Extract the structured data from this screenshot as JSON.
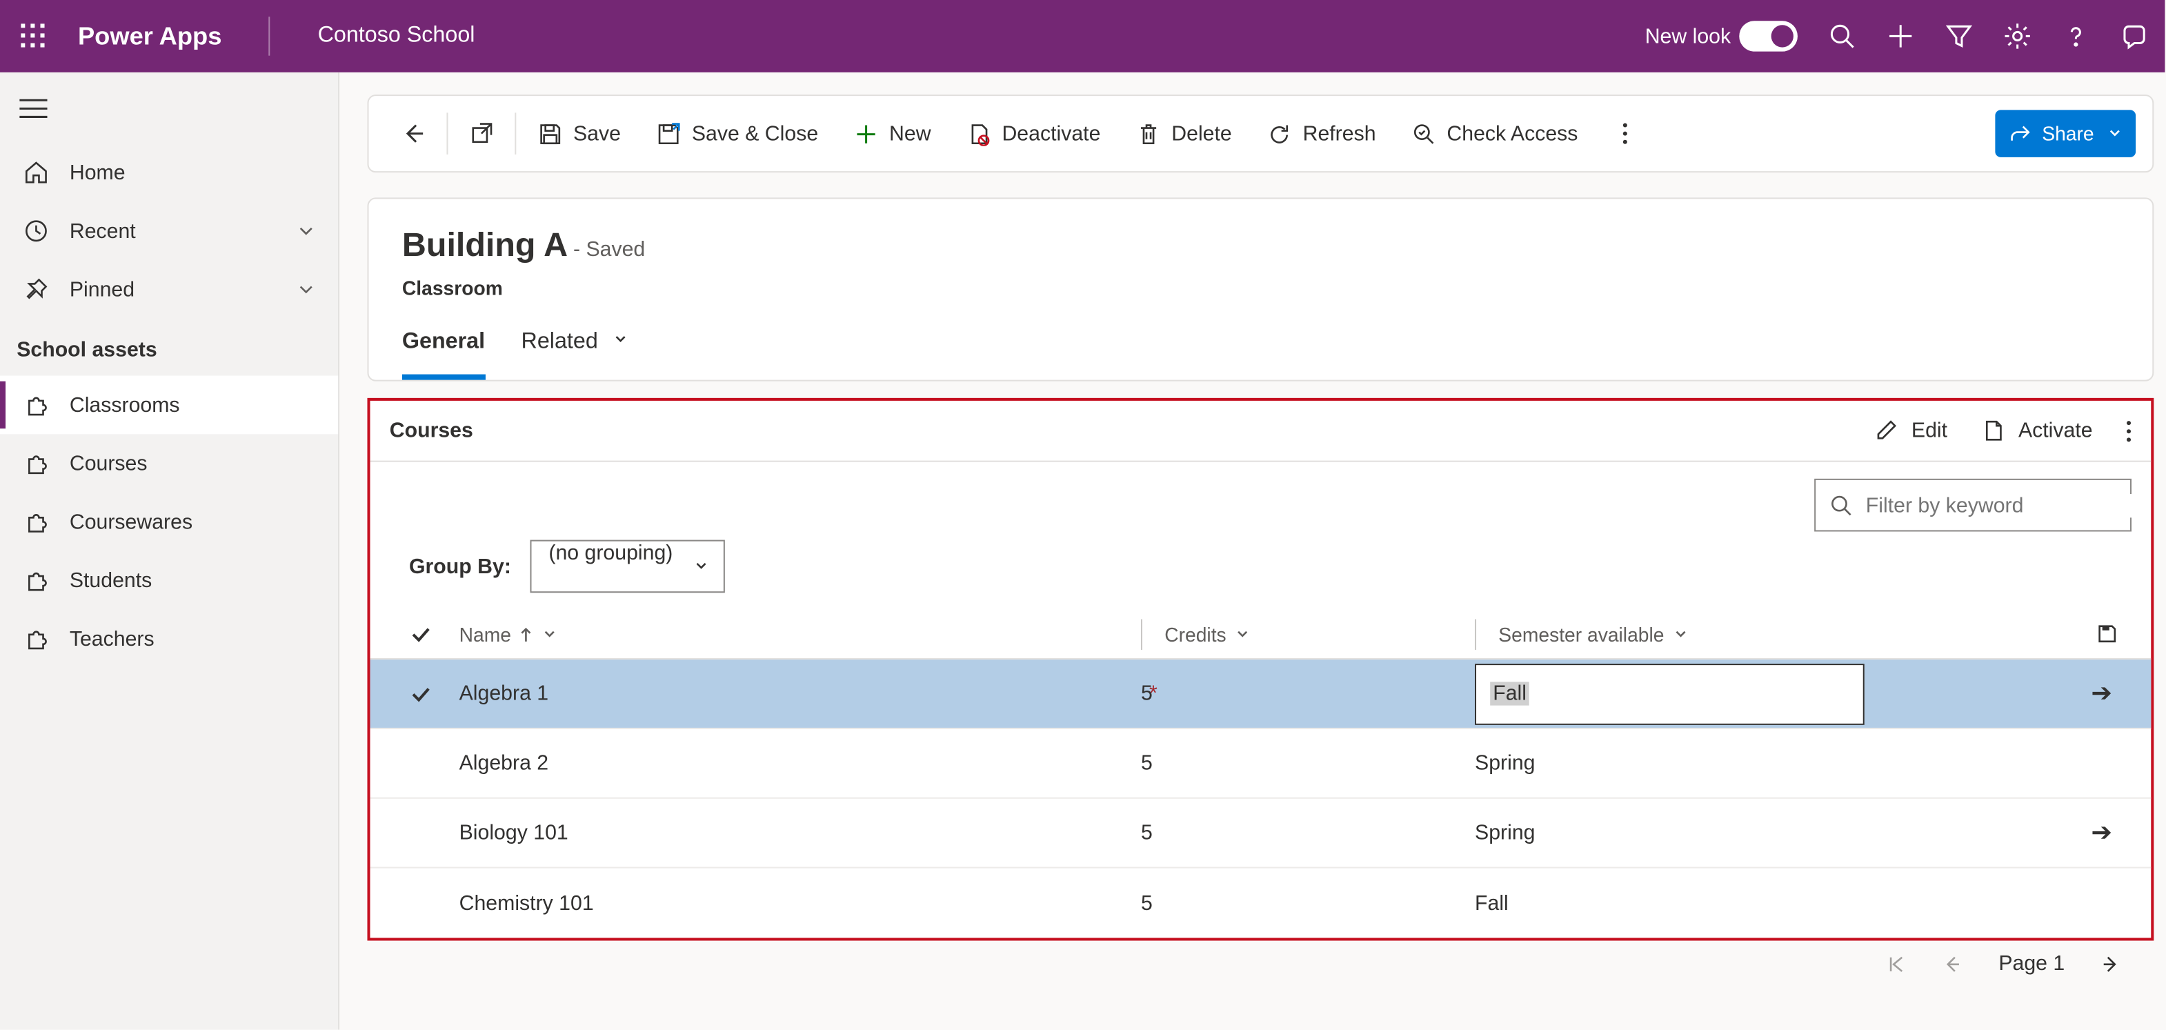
{
  "topbar": {
    "app_title": "Power Apps",
    "org_name": "Contoso School",
    "new_look_label": "New look"
  },
  "sidebar": {
    "home": "Home",
    "recent": "Recent",
    "pinned": "Pinned",
    "group": "School assets",
    "items": [
      "Classrooms",
      "Courses",
      "Coursewares",
      "Students",
      "Teachers"
    ]
  },
  "commandbar": {
    "save": "Save",
    "save_close": "Save & Close",
    "new": "New",
    "deactivate": "Deactivate",
    "delete": "Delete",
    "refresh": "Refresh",
    "check_access": "Check Access",
    "share": "Share"
  },
  "record": {
    "title": "Building A",
    "status": "- Saved",
    "subtitle": "Classroom",
    "tab_general": "General",
    "tab_related": "Related"
  },
  "subgrid": {
    "title": "Courses",
    "edit": "Edit",
    "activate": "Activate",
    "filter_placeholder": "Filter by keyword",
    "groupby_label": "Group By:",
    "groupby_value": "(no grouping)",
    "columns": {
      "name": "Name",
      "credits": "Credits",
      "semester": "Semester available"
    },
    "rows": [
      {
        "name": "Algebra 1",
        "credits": "5",
        "semester": "Fall",
        "editing": true,
        "selected": true,
        "required": true
      },
      {
        "name": "Algebra 2",
        "credits": "5",
        "semester": "Spring"
      },
      {
        "name": "Biology 101",
        "credits": "5",
        "semester": "Spring",
        "arrow": true
      },
      {
        "name": "Chemistry 101",
        "credits": "5",
        "semester": "Fall"
      }
    ]
  },
  "pager": {
    "page_label": "Page 1"
  }
}
